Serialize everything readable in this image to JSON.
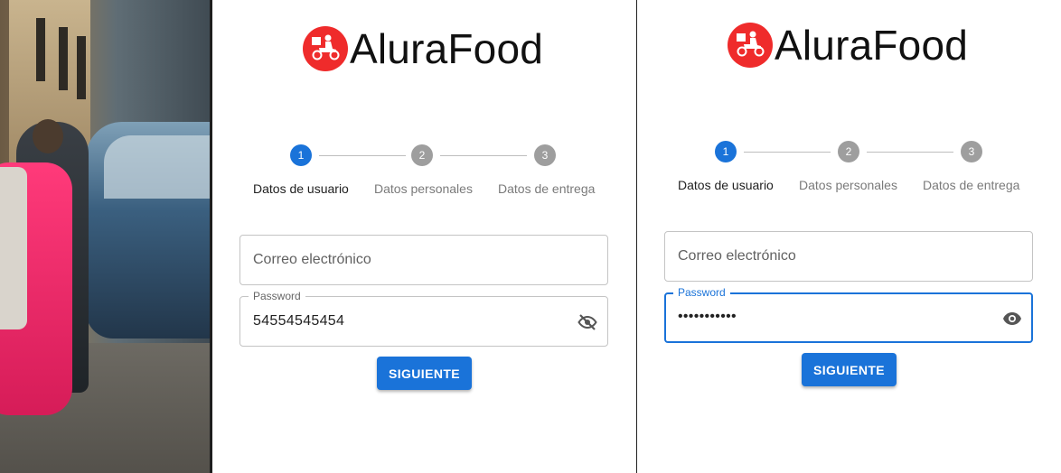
{
  "brand": {
    "name": "AluraFood",
    "logo_icon": "delivery-scooter-icon",
    "logo_color": "#ef2b2b"
  },
  "colors": {
    "primary": "#1a73d9",
    "inactive_step": "#9e9e9e"
  },
  "left_panel": {
    "steps": [
      {
        "number": "1",
        "label": "Datos de usuario"
      },
      {
        "number": "2",
        "label": "Datos personales"
      },
      {
        "number": "3",
        "label": "Datos de entrega"
      }
    ],
    "email": {
      "placeholder": "Correo electrónico"
    },
    "password": {
      "label": "Password",
      "value": "54554545454",
      "toggle_icon": "eye-off-icon"
    },
    "submit_label": "SIGUIENTE"
  },
  "right_panel": {
    "steps": [
      {
        "number": "1",
        "label": "Datos de usuario"
      },
      {
        "number": "2",
        "label": "Datos personales"
      },
      {
        "number": "3",
        "label": "Datos de entrega"
      }
    ],
    "email": {
      "placeholder": "Correo electrónico"
    },
    "password": {
      "label": "Password",
      "value": "•••••••••••",
      "toggle_icon": "eye-icon"
    },
    "submit_label": "SIGUIENTE"
  }
}
